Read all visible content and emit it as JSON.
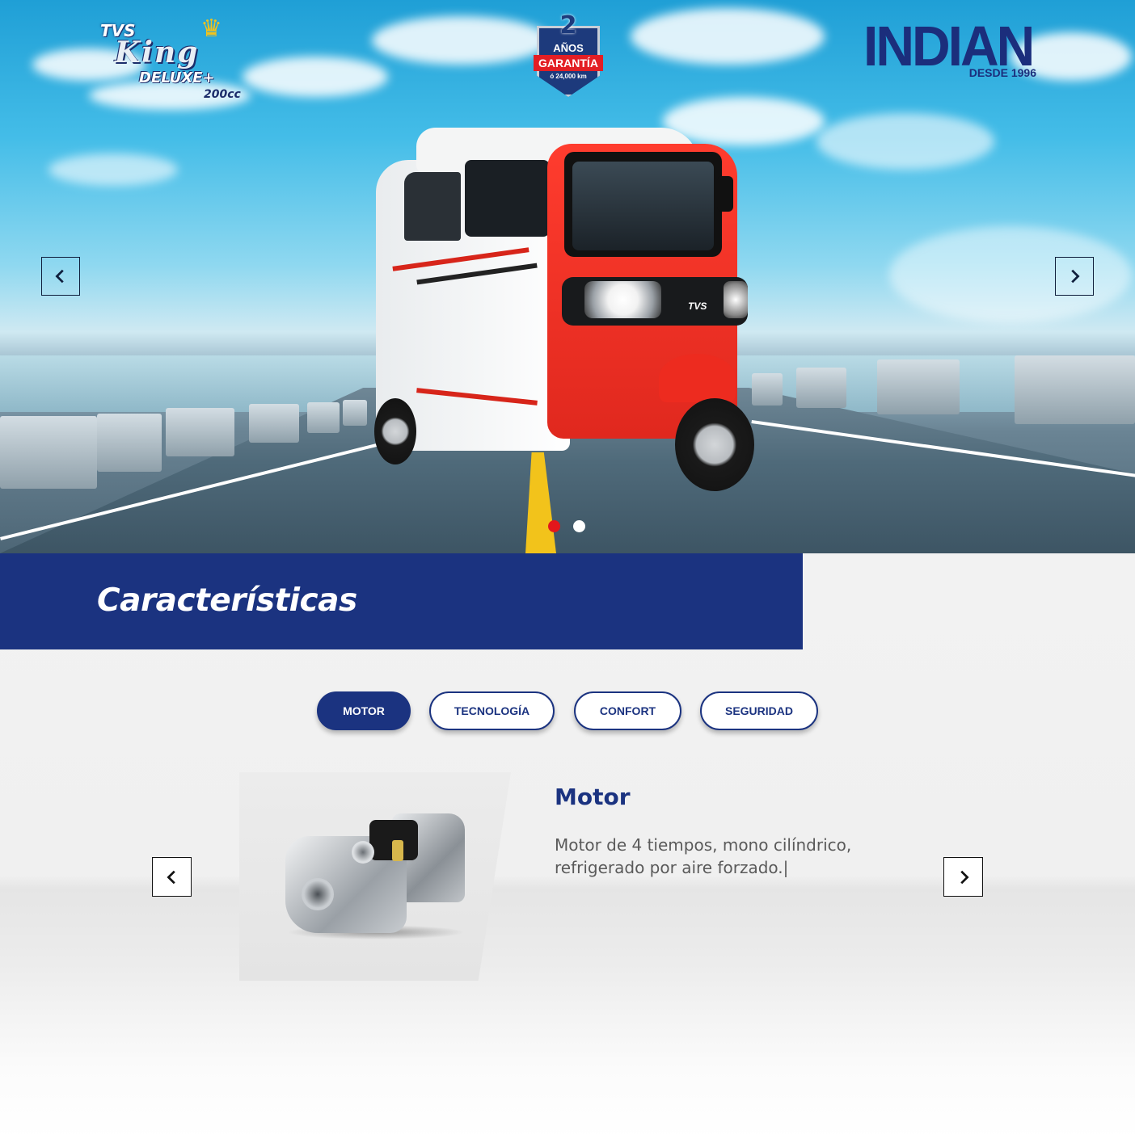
{
  "hero": {
    "tvs_logo": {
      "line1": "TVS",
      "line2": "King",
      "line3": "DELUXE+",
      "line4": "200cc"
    },
    "warranty_badge": {
      "number": "2",
      "unit": "AÑOS",
      "label": "GARANTÍA",
      "detail": "ó 24,000 km"
    },
    "indian_logo": {
      "name": "INDIAN",
      "tagline": "DESDE 1996"
    },
    "vehicle_brand": "TVS",
    "prev_icon": "chevron-left-icon",
    "next_icon": "chevron-right-icon",
    "slides": 2,
    "active_slide": 1,
    "colors": {
      "dot_active": "#e3161b",
      "dot_inactive": "#ffffff"
    }
  },
  "features": {
    "section_title": "Características",
    "tabs": [
      {
        "label": "MOTOR",
        "active": true
      },
      {
        "label": "TECNOLOGÍA",
        "active": false
      },
      {
        "label": "CONFORT",
        "active": false
      },
      {
        "label": "SEGURIDAD",
        "active": false
      }
    ],
    "current": {
      "title": "Motor",
      "description": "Motor de 4 tiempos, mono cilíndrico, refrigerado por aire forzado.|"
    },
    "prev_icon": "chevron-left-icon",
    "next_icon": "chevron-right-icon",
    "colors": {
      "brand_blue": "#1b3380",
      "text_gray": "#5a5a5a"
    }
  }
}
